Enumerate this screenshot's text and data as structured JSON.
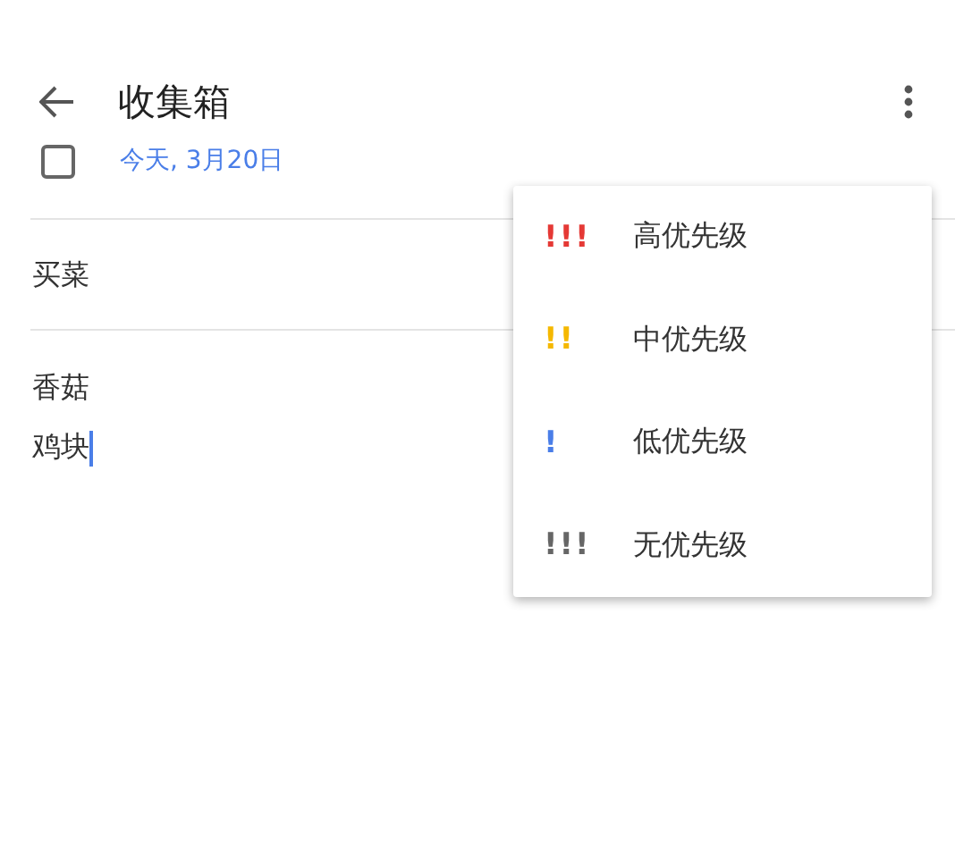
{
  "header": {
    "title": "收集箱"
  },
  "task": {
    "checked": false,
    "date": "今天, 3月20日",
    "title": "买菜",
    "note_lines": [
      "香菇",
      "鸡块"
    ]
  },
  "priority_menu": [
    {
      "mark": "!!!",
      "label": "高优先级",
      "color": "#e53935"
    },
    {
      "mark": "!!",
      "label": "中优先级",
      "color": "#f5b800"
    },
    {
      "mark": "!",
      "label": "低优先级",
      "color": "#4a7ee8"
    },
    {
      "mark": "!!!",
      "label": "无优先级",
      "color": "#666666"
    }
  ]
}
